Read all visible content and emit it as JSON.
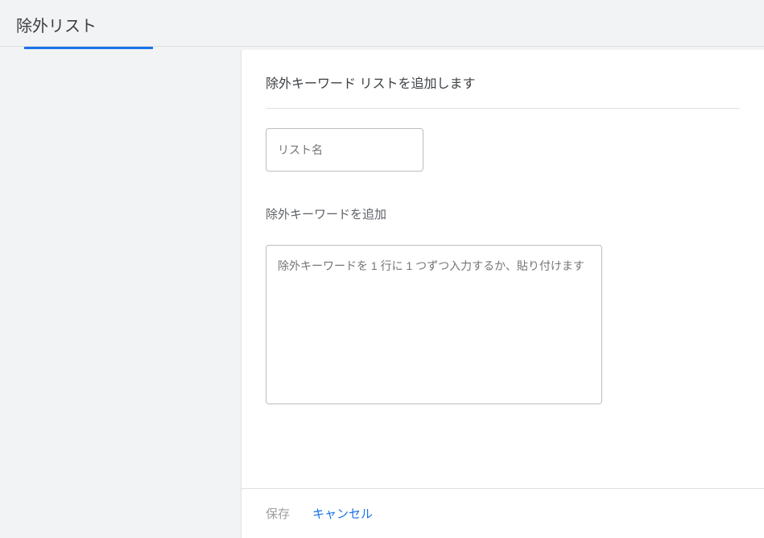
{
  "header": {
    "title": "除外リスト"
  },
  "panel": {
    "title": "除外キーワード リストを追加します",
    "list_name_placeholder": "リスト名",
    "section_label": "除外キーワードを追加",
    "textarea_placeholder": "除外キーワードを 1 行に 1 つずつ入力するか、貼り付けます"
  },
  "footer": {
    "save_label": "保存",
    "cancel_label": "キャンセル"
  }
}
